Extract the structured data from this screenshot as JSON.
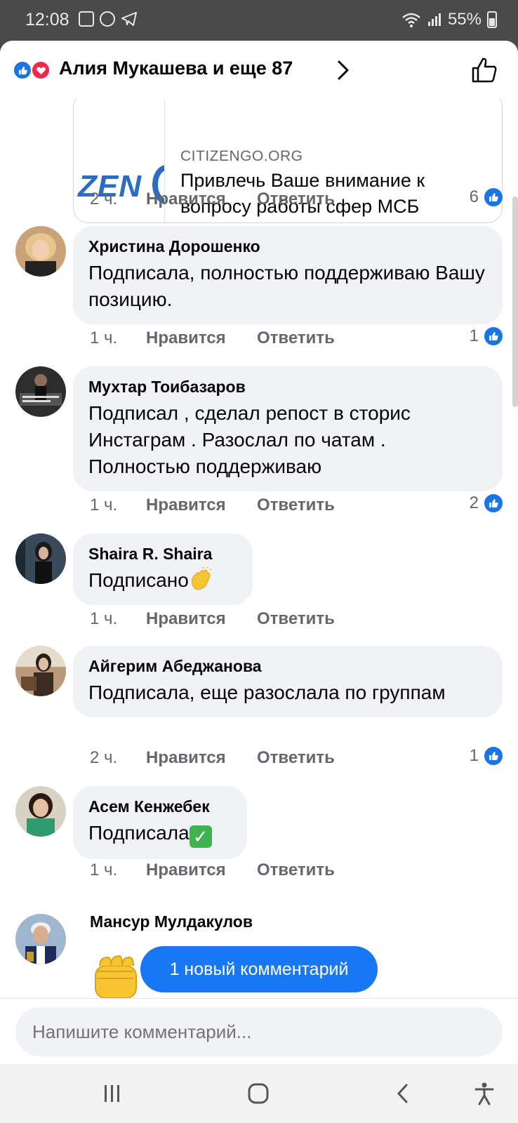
{
  "status_bar": {
    "time": "12:08",
    "battery": "55%"
  },
  "header": {
    "title": "Алия Мукашева и еще 87"
  },
  "link_card": {
    "domain": "CITIZENGO.ORG",
    "title": "Привлечь Ваше внимание к вопросу работы сфер МСБ",
    "logo_text": "ZEN",
    "meta": {
      "time": "2 ч.",
      "like": "Нравится",
      "reply": "Ответить",
      "reactions": "6"
    }
  },
  "comments": [
    {
      "name": "Христина Дорошенко",
      "text": "Подписала, полностью поддерживаю Вашу позицию.",
      "time": "1 ч.",
      "like": "Нравится",
      "reply": "Ответить",
      "reactions": "1"
    },
    {
      "name": "Мухтар Тоибазаров",
      "text": "Подписал , сделал репост в сторис Инстаграм . Разослал по чатам . Полностью поддерживаю",
      "time": "1 ч.",
      "like": "Нравится",
      "reply": "Ответить",
      "reactions": "2"
    },
    {
      "name": "Shaira R. Shaira",
      "text": "Подписано",
      "time": "1 ч.",
      "like": "Нравится",
      "reply": "Ответить",
      "reactions": ""
    },
    {
      "name": "Айгерим Абеджанова",
      "text": "Подписала, еще разослала по группам",
      "time": "2 ч.",
      "like": "Нравится",
      "reply": "Ответить",
      "reactions": "1"
    },
    {
      "name": "Асем Кенжебек",
      "text": "Подписала",
      "time": "1 ч.",
      "like": "Нравится",
      "reply": "Ответить",
      "reactions": ""
    },
    {
      "name": "Мансур Мулдакулов"
    }
  ],
  "new_comment_pill": "1 новый комментарий",
  "composer": {
    "placeholder": "Напишите комментарий..."
  },
  "colors": {
    "accent": "#1877f2",
    "like_blue": "#1b74e4",
    "love_red": "#f02849",
    "bubble": "#f0f2f5",
    "meta_gray": "#65676b"
  },
  "icons": [
    "like-reaction-icon",
    "love-reaction-icon",
    "chevron-right-icon",
    "thumbs-up-icon",
    "clapping-hands-emoji",
    "check-mark-emoji",
    "raised-fist-emoji",
    "recent-apps-icon",
    "home-icon",
    "back-icon",
    "accessibility-icon"
  ]
}
